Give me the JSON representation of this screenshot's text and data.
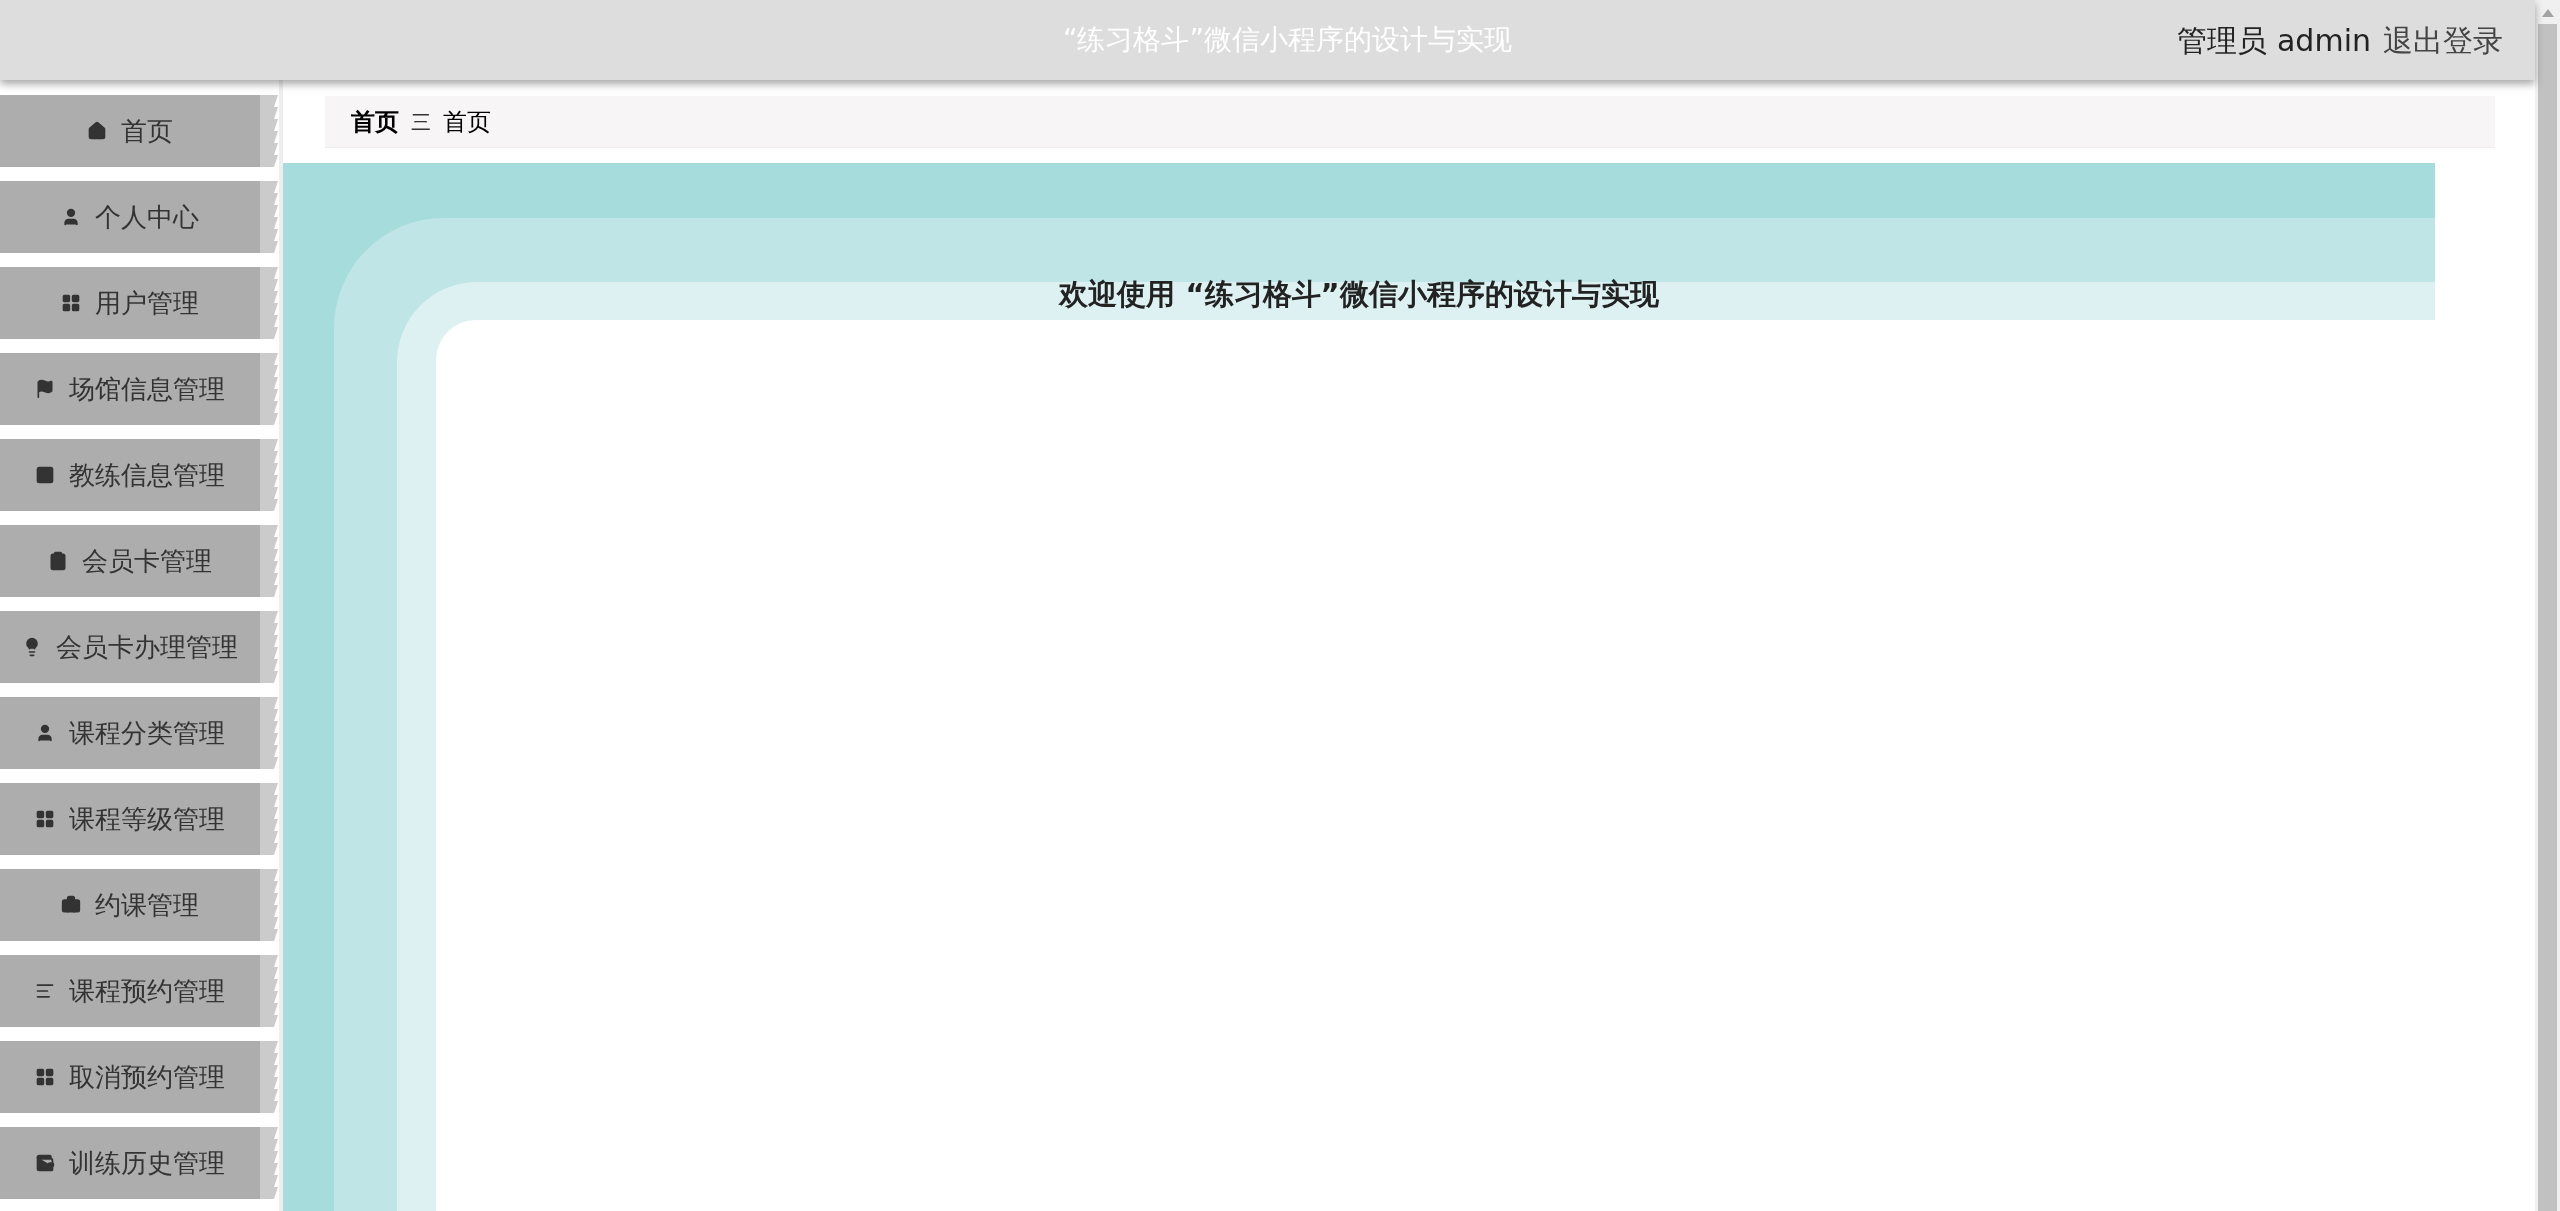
{
  "header": {
    "title": "“练习格斗”微信小程序的设计与实现",
    "user_role": "管理员 admin",
    "logout": "退出登录"
  },
  "sidebar": {
    "items": [
      {
        "label": "首页"
      },
      {
        "label": "个人中心"
      },
      {
        "label": "用户管理"
      },
      {
        "label": "场馆信息管理"
      },
      {
        "label": "教练信息管理"
      },
      {
        "label": "会员卡管理"
      },
      {
        "label": "会员卡办理管理"
      },
      {
        "label": "课程分类管理"
      },
      {
        "label": "课程等级管理"
      },
      {
        "label": "约课管理"
      },
      {
        "label": "课程预约管理"
      },
      {
        "label": "取消预约管理"
      },
      {
        "label": "训练历史管理"
      }
    ]
  },
  "breadcrumb": {
    "root": "首页",
    "separator": "三",
    "current": "首页"
  },
  "welcome": {
    "title": "欢迎使用 “练习格斗”微信小程序的设计与实现"
  }
}
